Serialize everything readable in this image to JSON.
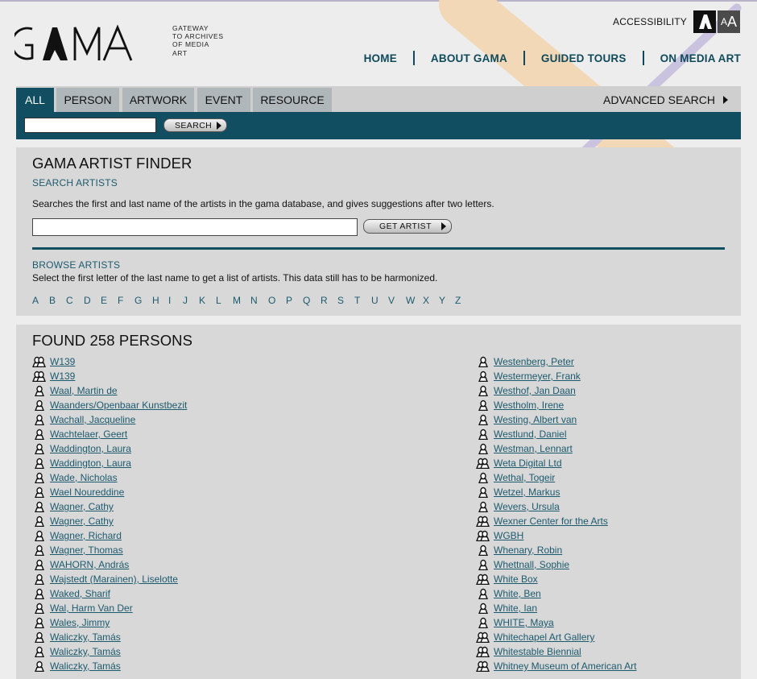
{
  "header": {
    "logo_text": "GAMA",
    "tagline": [
      "GATEWAY",
      "TO ARCHIVES",
      "OF MEDIA",
      "ART"
    ],
    "accessibility_label": "ACCESSIBILITY",
    "font_size_small": "A",
    "font_size_large": "A"
  },
  "nav": {
    "items": [
      "HOME",
      "ABOUT GAMA",
      "GUIDED TOURS",
      "ON MEDIA ART"
    ]
  },
  "search": {
    "tabs": [
      "ALL",
      "PERSON",
      "ARTWORK",
      "EVENT",
      "RESOURCE"
    ],
    "active_tab": "ALL",
    "advanced_label": "ADVANCED SEARCH",
    "button_label": "SEARCH",
    "query": ""
  },
  "finder": {
    "title": "GAMA ARTIST FINDER",
    "search_label": "SEARCH ARTISTS",
    "search_description": "Searches the first and last name of the artists in the gama database, and gives suggestions after two letters.",
    "button_label": "GET ARTIST",
    "query": "",
    "browse_label": "BROWSE ARTISTS",
    "browse_description": "Select the first letter of the last name to get a list of artists. This data still has to be harmonized.",
    "letters": [
      "A",
      "B",
      "C",
      "D",
      "E",
      "F",
      "G",
      "H",
      "I",
      "J",
      "K",
      "L",
      "M",
      "N",
      "O",
      "P",
      "Q",
      "R",
      "S",
      "T",
      "U",
      "V",
      "W",
      "X",
      "Y",
      "Z"
    ]
  },
  "results": {
    "title": "FOUND 258 PERSONS",
    "left_column": [
      {
        "name": "W139",
        "type": "group"
      },
      {
        "name": "W139",
        "type": "group"
      },
      {
        "name": "Waal, Martin de",
        "type": "person"
      },
      {
        "name": "Waanders/Openbaar Kunstbezit",
        "type": "person"
      },
      {
        "name": "Wachall, Jacqueline",
        "type": "person"
      },
      {
        "name": "Wachtelaer, Geert",
        "type": "person"
      },
      {
        "name": "Waddington, Laura",
        "type": "person"
      },
      {
        "name": "Waddington, Laura",
        "type": "person"
      },
      {
        "name": "Wade, Nicholas",
        "type": "person"
      },
      {
        "name": "Wael Noureddine",
        "type": "person"
      },
      {
        "name": "Wagner, Cathy",
        "type": "person"
      },
      {
        "name": "Wagner, Cathy",
        "type": "person"
      },
      {
        "name": "Wagner, Richard",
        "type": "person"
      },
      {
        "name": "Wagner, Thomas",
        "type": "person"
      },
      {
        "name": "WAHORN, András",
        "type": "person"
      },
      {
        "name": "Wajstedt (Marainen), Liselotte",
        "type": "person"
      },
      {
        "name": "Waked, Sharif",
        "type": "person"
      },
      {
        "name": "Wal, Harm Van Der",
        "type": "person"
      },
      {
        "name": "Wales, Jimmy",
        "type": "person"
      },
      {
        "name": "Waliczky, Tamás",
        "type": "person"
      },
      {
        "name": "Waliczky, Tamás",
        "type": "person"
      },
      {
        "name": "Waliczky, Tamás",
        "type": "person"
      }
    ],
    "right_column": [
      {
        "name": "Westenberg, Peter",
        "type": "person"
      },
      {
        "name": "Westermeyer, Frank",
        "type": "person"
      },
      {
        "name": "Westhof, Jan Daan",
        "type": "person"
      },
      {
        "name": "Westholm, Irene",
        "type": "person"
      },
      {
        "name": "Westing, Albert van",
        "type": "person"
      },
      {
        "name": "Westlund, Daniel",
        "type": "person"
      },
      {
        "name": "Westman, Lennart",
        "type": "person"
      },
      {
        "name": "Weta Digital Ltd",
        "type": "group"
      },
      {
        "name": "Wethal, Togeir",
        "type": "person"
      },
      {
        "name": "Wetzel, Markus",
        "type": "person"
      },
      {
        "name": "Wevers, Ursula",
        "type": "person"
      },
      {
        "name": "Wexner Center for the Arts",
        "type": "group"
      },
      {
        "name": "WGBH",
        "type": "group"
      },
      {
        "name": "Whenary, Robin",
        "type": "person"
      },
      {
        "name": "Whettnall, Sophie",
        "type": "person"
      },
      {
        "name": "White Box",
        "type": "group"
      },
      {
        "name": "White, Ben",
        "type": "person"
      },
      {
        "name": "White, Ian",
        "type": "person"
      },
      {
        "name": "WHITE, Maya",
        "type": "person"
      },
      {
        "name": "Whitechapel Art Gallery",
        "type": "group"
      },
      {
        "name": "Whitestable Biennial",
        "type": "group"
      },
      {
        "name": "Whitney Museum of American Art",
        "type": "group"
      }
    ]
  },
  "colors": {
    "brand_teal": "#114e61",
    "link": "#1c5a6e",
    "tab_inactive": "#b0b7ba",
    "panel": "#d8d8d8"
  },
  "icons": {
    "person": "person-icon",
    "group": "group-icon"
  }
}
